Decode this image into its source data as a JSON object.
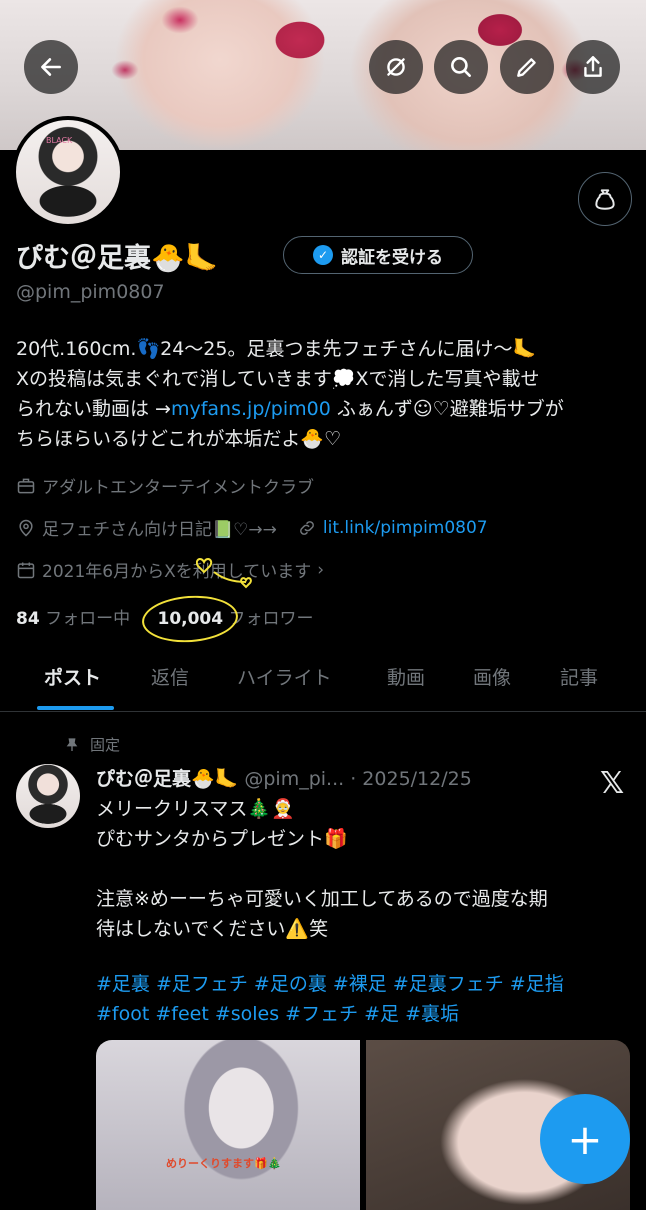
{
  "header": {
    "back_icon": "arrow-left-icon",
    "actions": [
      "hide-icon",
      "search-icon",
      "edit-icon",
      "share-icon"
    ]
  },
  "profile": {
    "avatar_tag": "BLACK",
    "name": "ぴむ＠足裏🐣🦶",
    "verify_label": "認証を受ける",
    "handle": "@pim_pim0807",
    "bio_line1": "20代.160cm.👣24〜25。足裏つま先フェチさんに届け～🦶",
    "bio_line2": "Xの投稿は気まぐれで消していきます💭Xで消した写真や載せ",
    "bio_line3_a": "られない動画は →",
    "bio_link": "myfans.jp/pim00",
    "bio_line3_b": " ふぁんず☺︎♡避難垢サブが",
    "bio_line4": "ちらほらいるけどこれが本垢だよ🐣♡",
    "category": "アダルトエンターテイメントクラブ",
    "location": "足フェチさん向け日記📗♡→→",
    "website": "lit.link/pimpim0807",
    "joined": "2021年6月からXを利用しています",
    "following_count": "84",
    "following_label": "フォロー中",
    "followers_count": "10,004",
    "followers_label": "フォロワー"
  },
  "tabs": [
    {
      "label": "ポスト",
      "active": true
    },
    {
      "label": "返信",
      "active": false
    },
    {
      "label": "ハイライト",
      "active": false
    },
    {
      "label": "動画",
      "active": false
    },
    {
      "label": "画像",
      "active": false
    },
    {
      "label": "記事",
      "active": false
    }
  ],
  "post": {
    "pinned_label": "固定",
    "author_name": "ぴむ＠足裏🐣🦶",
    "meta": "@pim_pi... · 2025/12/25",
    "line1": "メリークリスマス🎄🤶",
    "line2": "ぴむサンタからプレゼント🎁",
    "line3": "注意※めーーちゃ可愛いく加工してあるので過度な期",
    "line4": "待はしないでください⚠️笑",
    "hashtags_line1": "#足裏 #足フェチ #足の裏 #裸足 #足裏フェチ #足指",
    "hashtags_line2": "#foot #feet #soles #フェチ #足 #裏垢",
    "media_caption": "めりーくりすます🎁🎄"
  },
  "fab": {
    "label": "+"
  },
  "colors": {
    "accent": "#1d9bf0",
    "muted": "#71767b",
    "text": "#e7e9ea",
    "background": "#000000",
    "highlight_ring": "#f2e13a"
  }
}
